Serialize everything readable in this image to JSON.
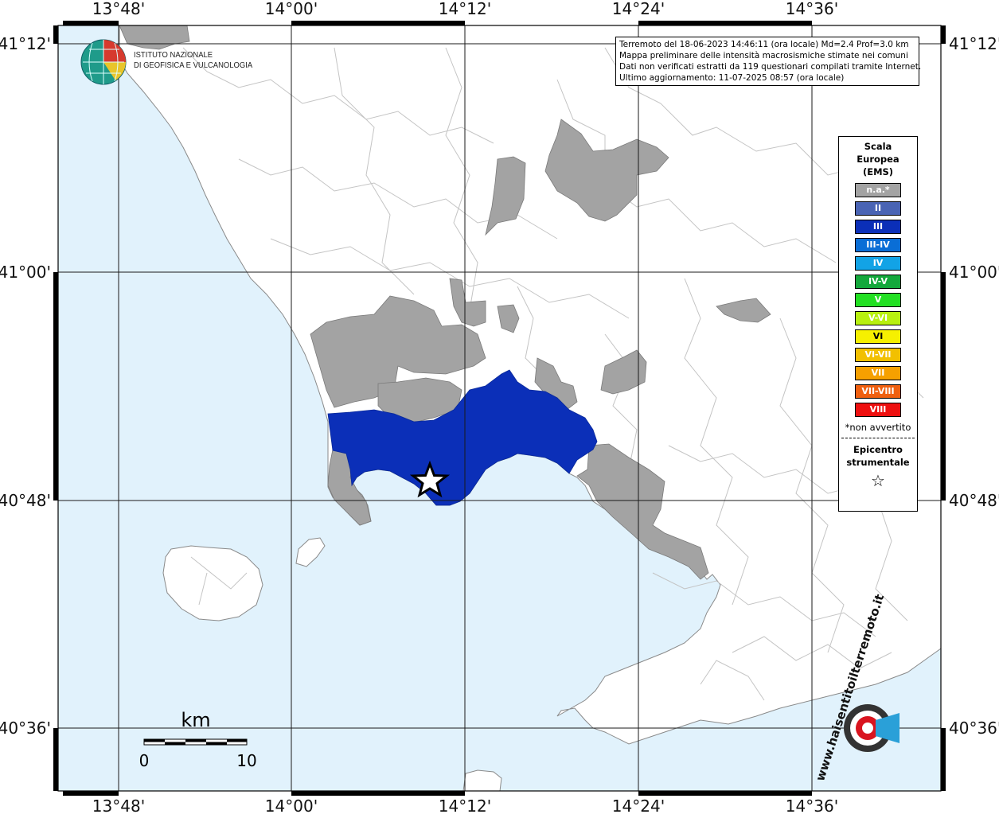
{
  "map": {
    "x_ticks": [
      "13°48'",
      "14°00'",
      "14°12'",
      "14°24'",
      "14°36'"
    ],
    "y_ticks": [
      "41°12'",
      "41°00'",
      "40°48'",
      "40°36'"
    ]
  },
  "info": {
    "line1": "Terremoto del 18-06-2023 14:46:11 (ora locale) Md=2.4 Prof=3.0 km",
    "line2": "Mappa preliminare delle intensità macrosismiche stimate nei comuni",
    "line3": "Dati non verificati estratti da 119 questionari compilati tramite Internet.",
    "line4": "Ultimo aggiornamento: 11-07-2025 08:57 (ora locale)"
  },
  "legend": {
    "title_1": "Scala",
    "title_2": "Europea",
    "title_3": "(EMS)",
    "items": [
      {
        "label": "n.a.*",
        "color": "#a3a3a3"
      },
      {
        "label": "II",
        "color": "#4a64b4"
      },
      {
        "label": "III",
        "color": "#0b2fb8"
      },
      {
        "label": "III-IV",
        "color": "#0a6ed6"
      },
      {
        "label": "IV",
        "color": "#12a3e6"
      },
      {
        "label": "IV-V",
        "color": "#14a83c"
      },
      {
        "label": "V",
        "color": "#22e022"
      },
      {
        "label": "V-VI",
        "color": "#b8f010"
      },
      {
        "label": "VI",
        "color": "#f6f000"
      },
      {
        "label": "VI-VII",
        "color": "#f2c000"
      },
      {
        "label": "VII",
        "color": "#f6a000"
      },
      {
        "label": "VII-VIII",
        "color": "#f06010"
      },
      {
        "label": "VIII",
        "color": "#ee1010"
      }
    ],
    "not_felt_note": "*non avvertito",
    "epicenter_1": "Epicentro",
    "epicenter_2": "strumentale",
    "epicenter_symbol": "☆"
  },
  "logo": {
    "line1": "ISTITUTO NAZIONALE",
    "line2": "DI GEOFISICA E VULCANOLOGIA"
  },
  "scale_bar": {
    "unit": "km",
    "start": "0",
    "end": "10"
  },
  "hsit_logo": {
    "text": "www.haisentitoilterremoto.it"
  },
  "colors": {
    "sea": "#e1f2fc",
    "land": "#ffffff",
    "not_available": "#a3a3a3",
    "intensity_III": "#0b2fb8"
  }
}
